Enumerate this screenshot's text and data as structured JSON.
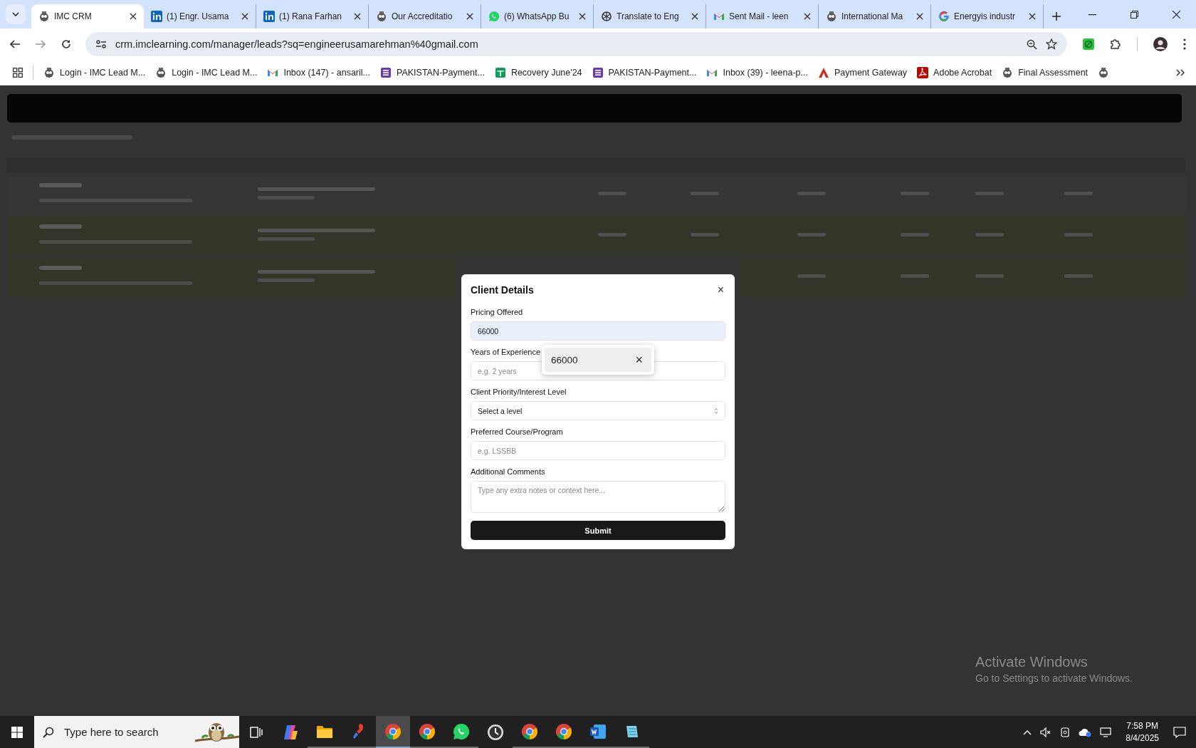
{
  "browser": {
    "tabs": [
      {
        "title": "IMC CRM",
        "kind": "owl",
        "selected": true
      },
      {
        "title": "(1) Engr. Usama",
        "kind": "linkedin",
        "selected": false
      },
      {
        "title": "(1) Rana Farhan",
        "kind": "linkedin",
        "selected": false
      },
      {
        "title": "Our Accreditatio",
        "kind": "owl",
        "selected": false
      },
      {
        "title": "(6) WhatsApp Bu",
        "kind": "whatsapp",
        "selected": false
      },
      {
        "title": "Translate to Eng",
        "kind": "ai",
        "selected": false
      },
      {
        "title": "Sent Mail - leen",
        "kind": "gmail",
        "selected": false
      },
      {
        "title": "International Ma",
        "kind": "owl",
        "selected": false
      },
      {
        "title": "Energyis industr",
        "kind": "google",
        "selected": false
      }
    ],
    "url": "crm.imclearning.com/manager/leads?sq=engineerusamarehman%40gmail.com",
    "bookmarks": [
      {
        "label": "Login - IMC Lead M...",
        "kind": "owl"
      },
      {
        "label": "Login - IMC Lead M...",
        "kind": "owl"
      },
      {
        "label": "Inbox (147) - ansaril...",
        "kind": "gmail"
      },
      {
        "label": "PAKISTAN-Payment...",
        "kind": "forms"
      },
      {
        "label": "Recovery June'24",
        "kind": "sheets"
      },
      {
        "label": "PAKISTAN-Payment...",
        "kind": "forms"
      },
      {
        "label": "Inbox (39) - leena-p...",
        "kind": "gmail"
      },
      {
        "label": "Payment Gateway",
        "kind": "payment"
      },
      {
        "label": "Adobe Acrobat",
        "kind": "acrobat"
      },
      {
        "label": "Final Assessment",
        "kind": "owl"
      },
      {
        "kind": "owl"
      }
    ]
  },
  "modal": {
    "title": "Client Details",
    "close": "×",
    "fields": [
      {
        "label": "Pricing Offered",
        "kind": "input",
        "value": "66000",
        "autofilled": true
      },
      {
        "label": "Years of Experience",
        "kind": "input",
        "placeholder": "e.g. 2 years",
        "autofilled": false
      },
      {
        "label": "Client Priority/Interest Level",
        "kind": "select",
        "value": "Select a level"
      },
      {
        "label": "Preferred Course/Program",
        "kind": "input",
        "placeholder": "e.g. LSSBB",
        "autofilled": false
      },
      {
        "label": "Additional Comments",
        "kind": "textarea",
        "placeholder": "Type any extra notes or context here..."
      }
    ],
    "submit": "Submit",
    "suggestion": {
      "value": "66000",
      "remove": "×"
    }
  },
  "windows_notice": {
    "title": "Activate Windows",
    "text": "Go to Settings to activate Windows."
  },
  "taskbar": {
    "search_placeholder": "Type here to search",
    "apps": [
      {
        "kind": "taskview",
        "selected": false
      },
      {
        "kind": "copilot",
        "selected": false
      },
      {
        "kind": "folder",
        "selected": false
      },
      {
        "kind": "paint",
        "selected": false
      },
      {
        "kind": "chrome",
        "selected": true
      },
      {
        "kind": "chrome",
        "selected": false
      },
      {
        "kind": "whatsapp",
        "selected": false
      },
      {
        "kind": "clock",
        "selected": false
      },
      {
        "kind": "chrome",
        "selected": false
      },
      {
        "kind": "chrome",
        "selected": false
      },
      {
        "kind": "word",
        "selected": false
      },
      {
        "kind": "notepad",
        "selected": false
      }
    ],
    "time": "7:58 PM",
    "date": "8/4/2025"
  }
}
